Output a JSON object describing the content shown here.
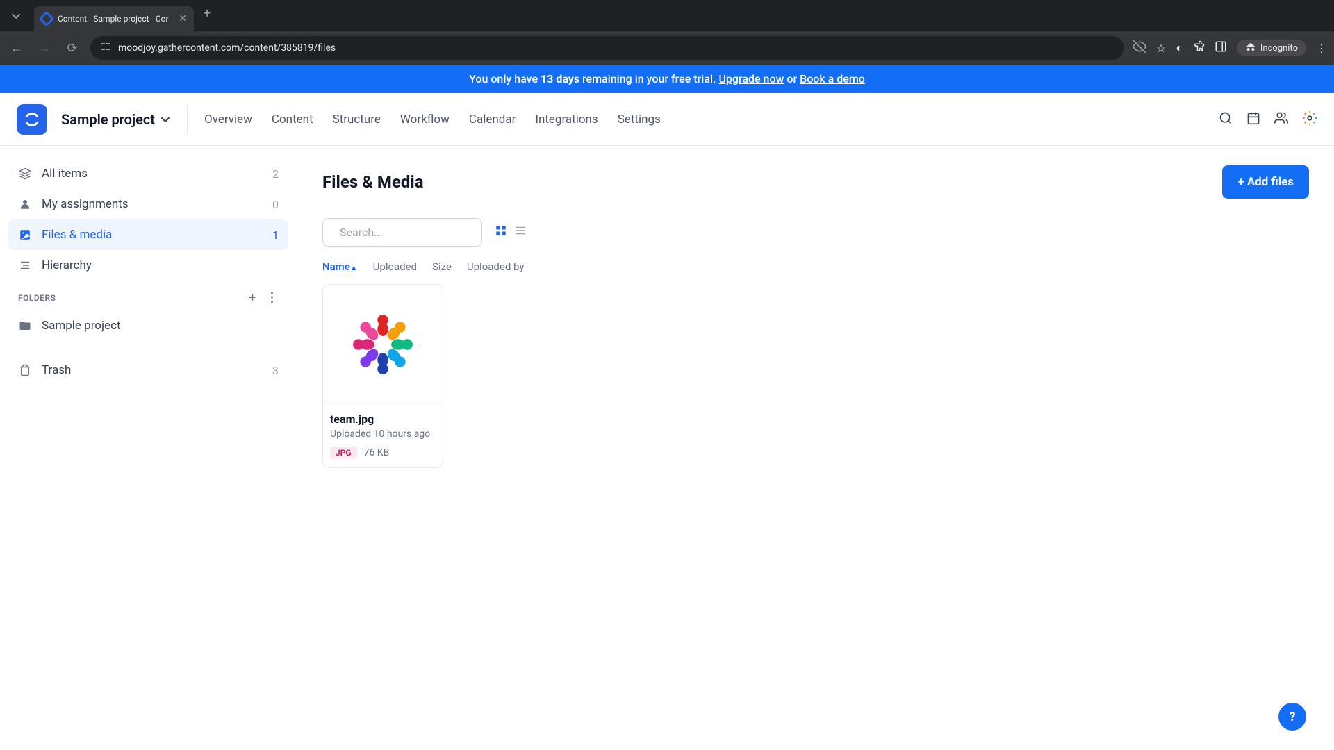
{
  "browser": {
    "tab_title": "Content - Sample project - Cor",
    "url": "moodjoy.gathercontent.com/content/385819/files",
    "incognito_label": "Incognito"
  },
  "banner": {
    "prefix": "You only have ",
    "days": "13 days",
    "middle": " remaining in your free trial. ",
    "upgrade": "Upgrade now",
    "or": " or ",
    "book": "Book a demo"
  },
  "nav": {
    "project_name": "Sample project",
    "tabs": [
      "Overview",
      "Content",
      "Structure",
      "Workflow",
      "Calendar",
      "Integrations",
      "Settings"
    ]
  },
  "sidebar": {
    "items": [
      {
        "label": "All items",
        "count": "2"
      },
      {
        "label": "My assignments",
        "count": "0"
      },
      {
        "label": "Files & media",
        "count": "1"
      },
      {
        "label": "Hierarchy",
        "count": ""
      }
    ],
    "folders_label": "FOLDERS",
    "folders": [
      {
        "label": "Sample project"
      }
    ],
    "trash_label": "Trash",
    "trash_count": "3"
  },
  "main": {
    "title": "Files & Media",
    "add_button": "Add files",
    "search_placeholder": "Search...",
    "sort_columns": [
      "Name",
      "Uploaded",
      "Size",
      "Uploaded by"
    ],
    "files": [
      {
        "name": "team.jpg",
        "uploaded": "Uploaded 10 hours ago",
        "badge": "JPG",
        "size": "76 KB"
      }
    ]
  }
}
